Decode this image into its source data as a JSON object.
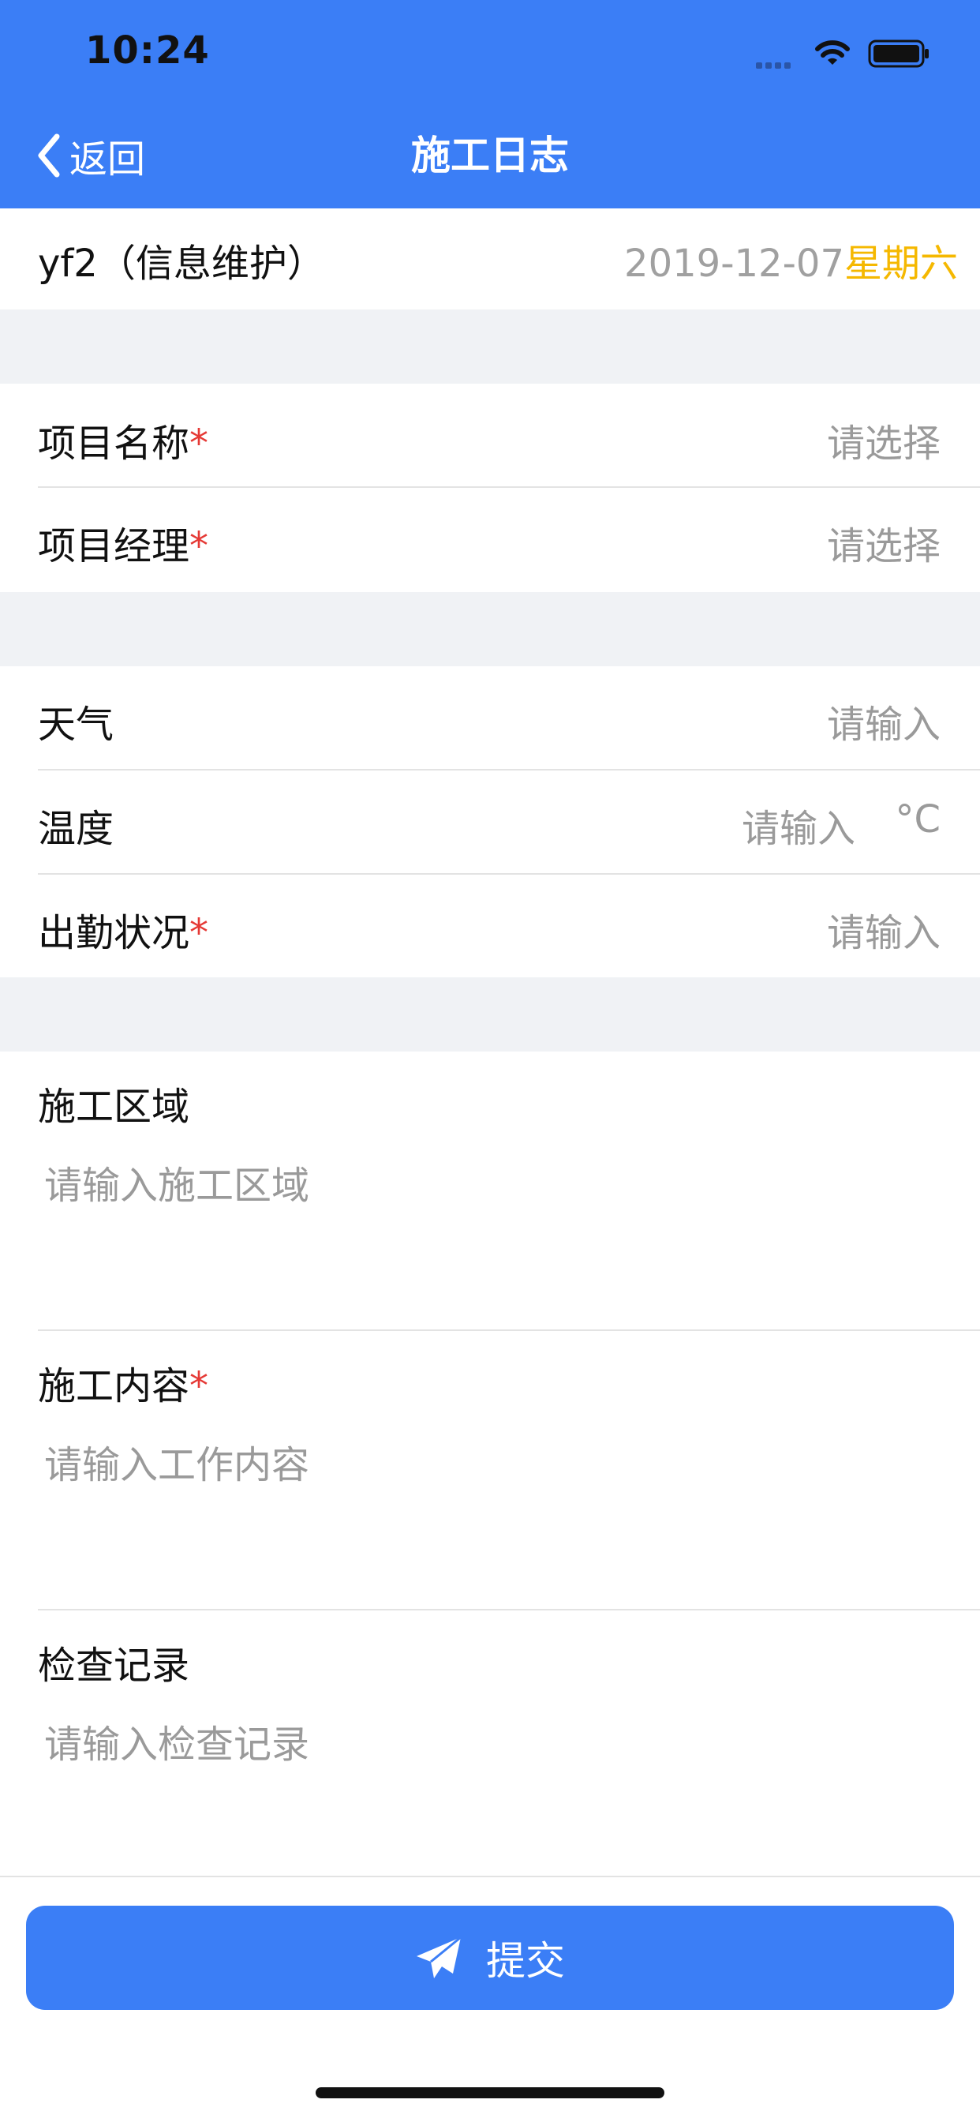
{
  "status_bar": {
    "time": "10:24"
  },
  "nav": {
    "back_label": "返回",
    "title": "施工日志"
  },
  "info": {
    "user": "yf2（信息维护）",
    "date": "2019-12-07",
    "weekday": "星期六"
  },
  "section1": [
    {
      "label": "项目名称",
      "required": "*",
      "value": "请选择"
    },
    {
      "label": "项目经理",
      "required": "*",
      "value": "请选择"
    }
  ],
  "section2": {
    "weather": {
      "label": "天气",
      "placeholder": "请输入"
    },
    "temperature": {
      "label": "温度",
      "placeholder": "请输入",
      "unit": "°C"
    },
    "attendance": {
      "label": "出勤状况",
      "required": "*",
      "placeholder": "请输入"
    }
  },
  "section3": {
    "area": {
      "label": "施工区域",
      "placeholder": "请输入施工区域"
    },
    "content": {
      "label": "施工内容",
      "required": "*",
      "placeholder": "请输入工作内容"
    },
    "inspection": {
      "label": "检查记录",
      "placeholder": "请输入检查记录"
    }
  },
  "submit": {
    "label": "提交"
  },
  "colors": {
    "primary": "#3b7ef6",
    "accent": "#f5b800",
    "required": "#e53935"
  }
}
